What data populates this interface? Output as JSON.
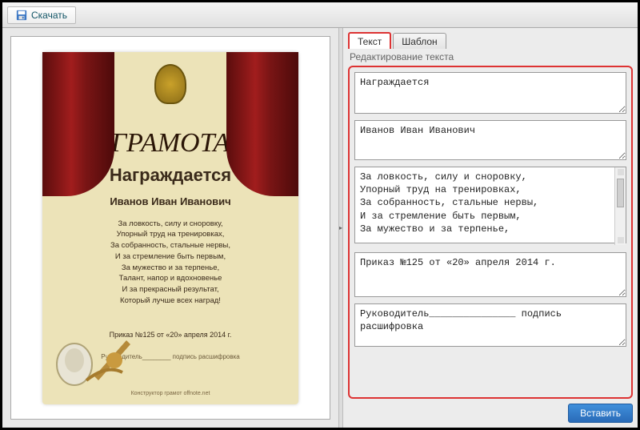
{
  "toolbar": {
    "download_label": "Скачать"
  },
  "preview": {
    "gramota_title": "ГРАМОТА",
    "award_label": "Награждается",
    "recipient": "Иванов Иван Иванович",
    "poem_lines": [
      "За ловкость, силу и сноровку,",
      "Упорный труд на тренировках,",
      "За собранность, стальные нервы,",
      "И за стремление быть первым,",
      "За мужество и за терпенье,",
      "Талант, напор и вдохновенье",
      "И за прекрасный результат,",
      "Который лучше всех наград!"
    ],
    "order_text": "Приказ №125 от «20» апреля 2014 г.",
    "sign_text": "Руководитель________ подпись расшифровка",
    "footer_text": "Конструктор грамот offnote.net"
  },
  "tabs": {
    "text": "Текст",
    "template": "Шаблон"
  },
  "subheader": "Редактирование текста",
  "fields": {
    "f1": "Награждается",
    "f2": "Иванов Иван Иванович",
    "f3": "За ловкость, силу и сноровку,\nУпорный труд на тренировках,\nЗа собранность, стальные нервы,\nИ за стремление быть первым,\nЗа мужество и за терпенье,",
    "f4": "Приказ №125 от «20» апреля 2014 г.",
    "f5": "Руководитель_______________ подпись расшифровка"
  },
  "actions": {
    "insert_label": "Вставить"
  }
}
